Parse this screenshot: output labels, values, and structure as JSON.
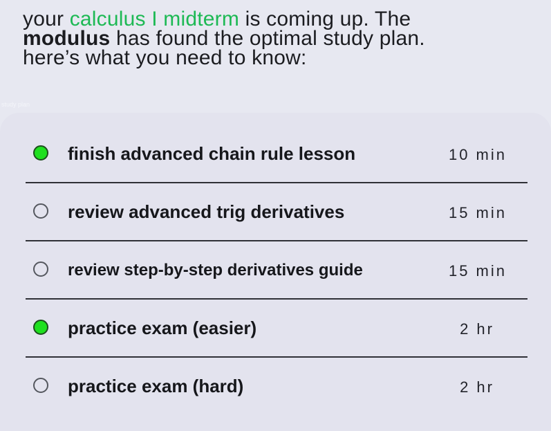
{
  "intro": {
    "line1_prefix": "your ",
    "course": "calculus I midterm",
    "line1_suffix": " is coming up. The",
    "brand": "modulus",
    "line2_suffix": " has found the optimal study plan.",
    "line3": "here’s what you need to know:"
  },
  "section_tag": "study plan",
  "colors": {
    "accent": "#1db954",
    "done_dot": "#1fe01f",
    "background": "#e7e8f1",
    "card": "#e3e3ee"
  },
  "plan": {
    "items": [
      {
        "label": "finish advanced chain rule lesson",
        "duration": "10 min",
        "done": true
      },
      {
        "label": "review advanced trig derivatives",
        "duration": "15 min",
        "done": false
      },
      {
        "label": "review step-by-step derivatives guide",
        "duration": "15 min",
        "done": false
      },
      {
        "label": "practice exam (easier)",
        "duration": "2 hr",
        "done": true
      },
      {
        "label": "practice exam (hard)",
        "duration": "2 hr",
        "done": false
      }
    ]
  }
}
